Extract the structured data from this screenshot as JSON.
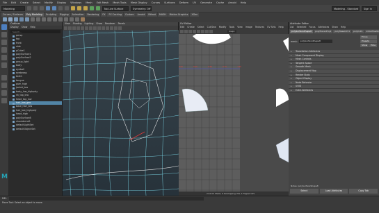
{
  "menubar": {
    "items": [
      "File",
      "Edit",
      "Create",
      "Select",
      "Modify",
      "Display",
      "Windows",
      "Mesh",
      "Edit Mesh",
      "Mesh Tools",
      "Mesh Display",
      "Curves",
      "Surfaces",
      "Deform",
      "UV",
      "Generate",
      "Cache",
      "Arnold",
      "Help"
    ],
    "workspace": "Modeling - Standard",
    "user": "Sign In"
  },
  "statusline": {
    "mode": "Modeling",
    "snap": "No Live Surface",
    "symmetry": "Symmetry: Off"
  },
  "shelf": {
    "tabs": [
      "Curves / Surfaces",
      "Poly Modeling",
      "Sculpting",
      "Rigging",
      "Animation",
      "Rendering",
      "FX",
      "FX Caching",
      "Custom",
      "Arnold",
      "Bifrost",
      "MASH",
      "Motion Graphics",
      "XGen"
    ],
    "active_tab": "Poly Modeling"
  },
  "outliner": {
    "title": "Outliner",
    "menu": [
      "Display",
      "Show",
      "Help"
    ],
    "search_placeholder": "Search...",
    "items": [
      "persp",
      "top",
      "front",
      "side",
      "pCube1",
      "polySurface1",
      "polySurface2",
      "group_light",
      "body",
      "eyeball",
      "eyebrows",
      "teeth",
      "tongue",
      "gum_high",
      "jacket_low",
      "body_low_highpoly",
      "sh_top_low",
      "head_top_low",
      "hair_low_geo",
      "base_hair_low",
      "hair_low_highpoly",
      "head_high",
      "polySurface8",
      "shoulderLeft",
      "defaultLightSet",
      "defaultObjectSet"
    ],
    "selected_index": 18
  },
  "viewport": {
    "menu": [
      "View",
      "Shading",
      "Lighting",
      "Show",
      "Renderer",
      "Panels"
    ]
  },
  "uv_editor": {
    "title": "UV Editor",
    "menu": [
      "Edit",
      "Create",
      "Select",
      "Cut/Sew",
      "Modify",
      "Tools",
      "View",
      "Image",
      "Textures",
      "UV Sets",
      "Help"
    ],
    "uv_set": "map1",
    "tick_labels": [
      "0.00",
      "0.25",
      "0.50",
      "0.75",
      "1.00"
    ],
    "status": "2.61 UV Shells, 0 Overlapping UVs, 1 Flipped UVs"
  },
  "attribute_editor": {
    "title": "Attribute Editor",
    "menu": [
      "List",
      "Selected",
      "Focus",
      "Attributes",
      "Show",
      "Help"
    ],
    "tabs": [
      "polySurfaceShape8",
      "polyPlanarProj1",
      "polyTweakUV1",
      "polyCut1",
      "initialShading"
    ],
    "node_label": "mesh:",
    "node_value": "polySurfaceShape8",
    "buttons_right": [
      "Focus",
      "Presets",
      "Show",
      "Hide"
    ],
    "sections": [
      "Tessellation Attributes",
      "Mesh Component Display",
      "Mesh Controls",
      "Tangent Space",
      "Smooth Mesh",
      "Displacement Map",
      "Render Stats",
      "Object Display",
      "Node Behavior",
      "UUID",
      "Extra Attributes"
    ],
    "notes_label": "Notes: polySurfaceShape8",
    "bottom_buttons": [
      "Select",
      "Load Attributes",
      "Copy Tab"
    ]
  },
  "helpline": {
    "mel_label": "MEL",
    "help_text": "Move Tool: Select an object to move."
  }
}
